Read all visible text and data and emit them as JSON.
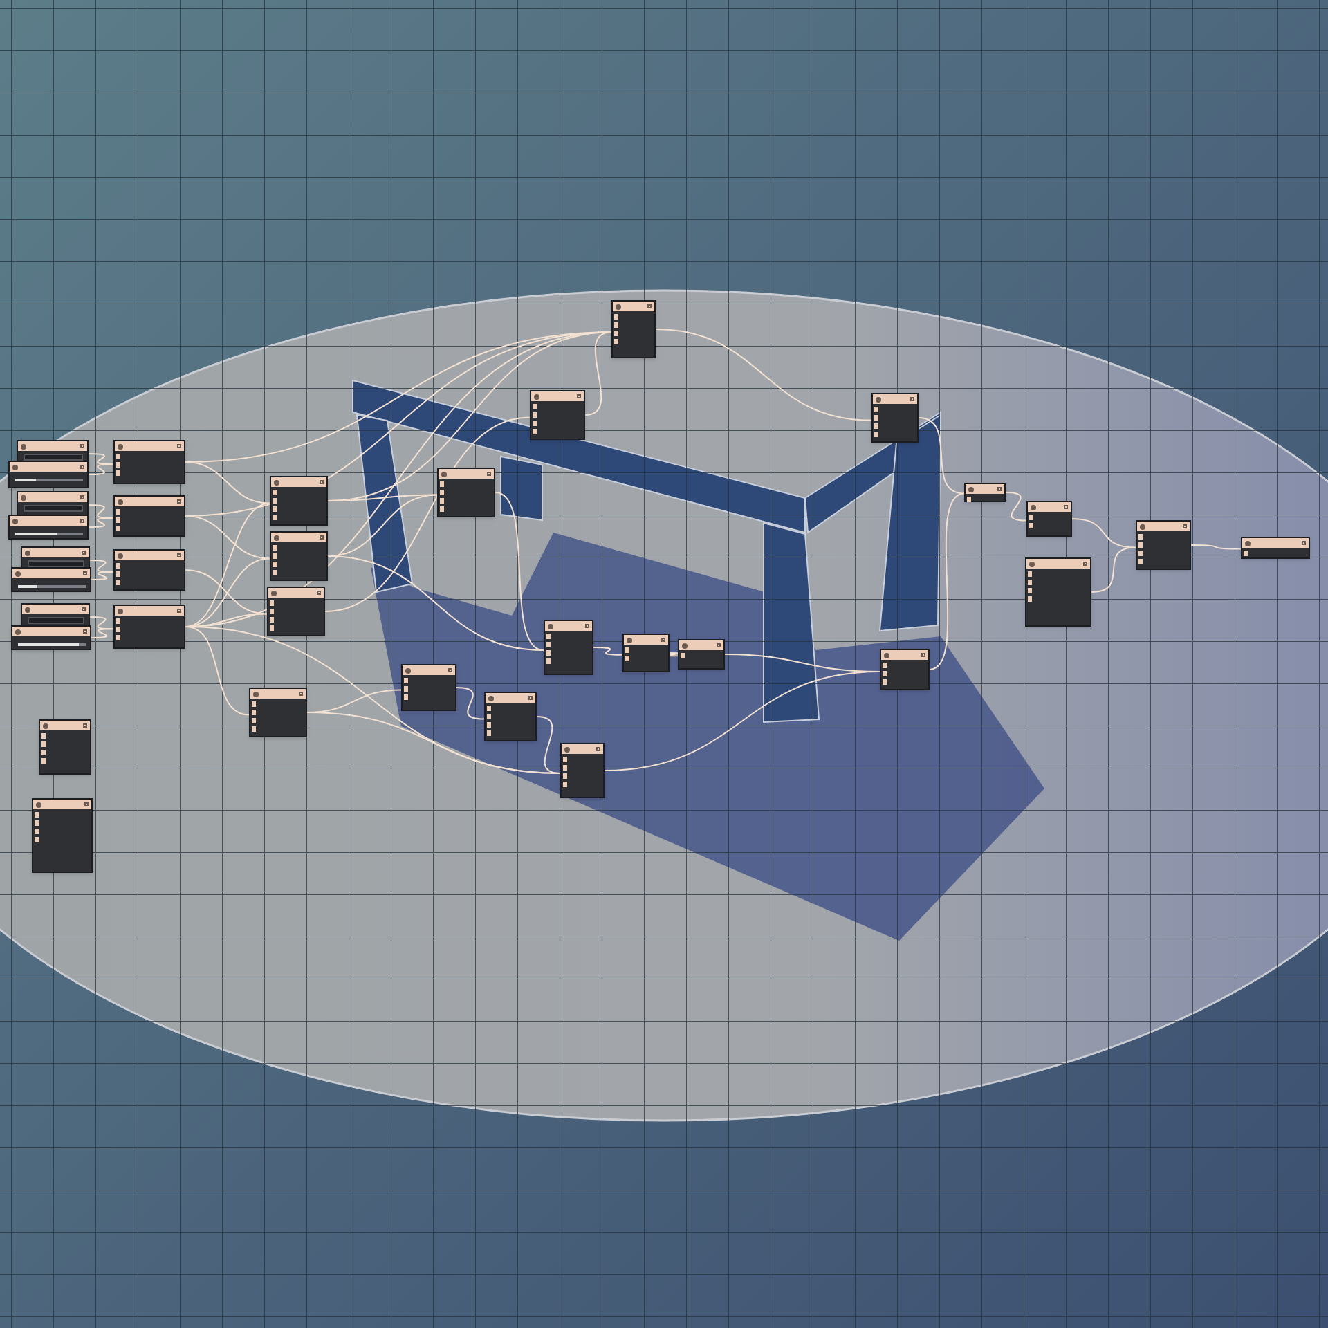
{
  "nodes": [
    {
      "kind": "input"
    },
    {
      "kind": "slider",
      "level": 0.3
    },
    {
      "kind": "input"
    },
    {
      "kind": "slider",
      "level": 0.62
    },
    {
      "kind": "input"
    },
    {
      "kind": "slider",
      "level": 0.28
    },
    {
      "kind": "input"
    },
    {
      "kind": "slider",
      "level": 0.9
    },
    {
      "kind": "node"
    },
    {
      "kind": "node"
    },
    {
      "kind": "node"
    },
    {
      "kind": "node"
    },
    {
      "kind": "node"
    },
    {
      "kind": "node"
    },
    {
      "kind": "node"
    },
    {
      "kind": "node"
    },
    {
      "kind": "node"
    },
    {
      "kind": "node"
    },
    {
      "kind": "node"
    },
    {
      "kind": "node"
    },
    {
      "kind": "node"
    },
    {
      "kind": "node"
    },
    {
      "kind": "node"
    },
    {
      "kind": "node"
    },
    {
      "kind": "node"
    },
    {
      "kind": "node"
    },
    {
      "kind": "node"
    },
    {
      "kind": "node"
    },
    {
      "kind": "node"
    },
    {
      "kind": "node"
    },
    {
      "kind": "node"
    },
    {
      "kind": "node"
    },
    {
      "kind": "node"
    },
    {
      "kind": "node"
    }
  ]
}
